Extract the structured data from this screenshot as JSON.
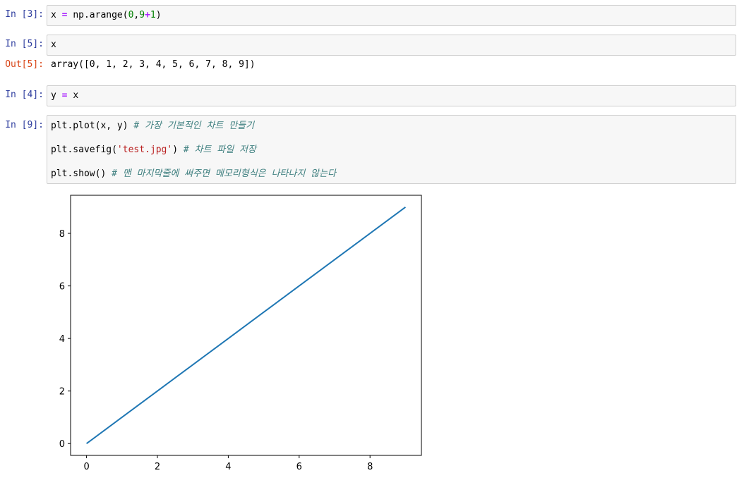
{
  "cells": [
    {
      "prompt": "In [3]:",
      "code": {
        "var": "x",
        "op": "=",
        "call": "np.arange(",
        "a": "0",
        "sep": ",",
        "b": "9",
        "plus": "+",
        "c": "1",
        "close": ")"
      }
    },
    {
      "prompt": "In [5]:",
      "code": {
        "var": "x"
      },
      "out_prompt": "Out[5]:",
      "output": "array([0, 1, 2, 3, 4, 5, 6, 7, 8, 9])"
    },
    {
      "prompt": "In [4]:",
      "code": {
        "var": "y",
        "op": "=",
        "rhs": "x"
      }
    },
    {
      "prompt": "In [9]:",
      "lines": [
        {
          "code": "plt.plot(x, y) ",
          "comment": "# 가장 기본적인 차트 만들기"
        },
        {
          "code_pre": "plt.savefig(",
          "str": "'test.jpg'",
          "code_post": ") ",
          "comment": "# 차트 파일 저장"
        },
        {
          "code": "plt.show() ",
          "comment": "# 맨 마지막줄에 써주면 메모리형식은 나타나지 않는다"
        }
      ]
    }
  ],
  "colors": {
    "in_prompt": "#303f9f",
    "out_prompt": "#d84315",
    "line": "#1f77b4",
    "cell_bg": "#f7f7f7",
    "cell_border": "#cfcfcf"
  },
  "chart_data": {
    "type": "line",
    "x": [
      0,
      1,
      2,
      3,
      4,
      5,
      6,
      7,
      8,
      9
    ],
    "series": [
      {
        "values": [
          0,
          1,
          2,
          3,
          4,
          5,
          6,
          7,
          8,
          9
        ],
        "color": "#1f77b4"
      }
    ],
    "xticks": [
      "0",
      "2",
      "4",
      "6",
      "8"
    ],
    "yticks": [
      "0",
      "2",
      "4",
      "6",
      "8"
    ],
    "xlim": [
      -0.45,
      9.45
    ],
    "ylim": [
      -0.45,
      9.45
    ],
    "grid": false,
    "title": "",
    "xlabel": "",
    "ylabel": ""
  }
}
